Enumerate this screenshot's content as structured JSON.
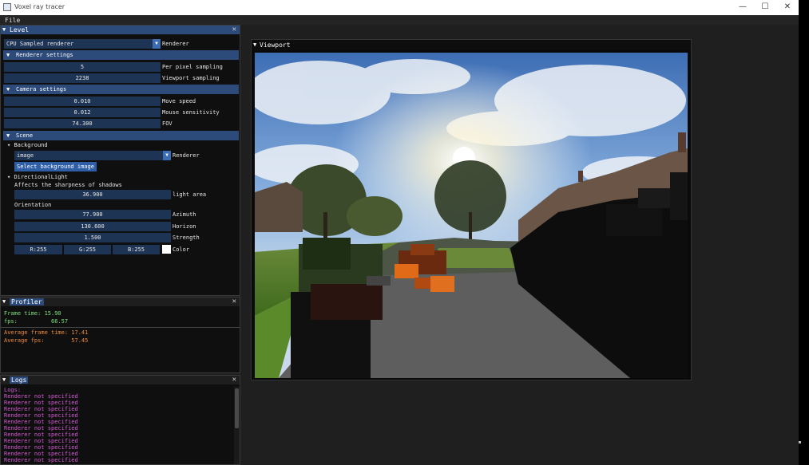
{
  "app": {
    "title": "Voxel ray tracer",
    "window_buttons": {
      "minimize": "—",
      "maximize": "☐",
      "close": "✕"
    }
  },
  "menu": {
    "file": "File"
  },
  "level_panel": {
    "title": "Level",
    "renderer_select": {
      "value": "CPU Sampled renderer",
      "label": "Renderer"
    },
    "renderer_settings": {
      "header": "Renderer settings",
      "per_pixel_sampling": {
        "value": "5",
        "label": "Per pixel sampling"
      },
      "viewport_sampling": {
        "value": "2238",
        "label": "Viewport sampling"
      }
    },
    "camera_settings": {
      "header": "Camera settings",
      "move_speed": {
        "value": "0.010",
        "label": "Move speed"
      },
      "mouse_sensitivity": {
        "value": "0.012",
        "label": "Mouse sensitivity"
      },
      "fov": {
        "value": "74.300",
        "label": "FOV"
      }
    },
    "scene": {
      "header": "Scene",
      "background": {
        "node": "Background",
        "renderer_select": {
          "value": "image",
          "label": "Renderer"
        },
        "select_button": "Select background image"
      },
      "directional_light": {
        "node": "DirectionalLight",
        "hint": "Affects the sharpness of shadows",
        "light_area": {
          "value": "36.900",
          "label": "light area"
        },
        "orientation_label": "Orientation",
        "azimuth": {
          "value": "77.900",
          "label": "Azimuth"
        },
        "horizon": {
          "value": "130.600",
          "label": "Horizon"
        },
        "strength": {
          "value": "1.500",
          "label": "Strength"
        },
        "color": {
          "r": "R:255",
          "g": "G:255",
          "b": "B:255",
          "label": "Color",
          "swatch": "#ffffff"
        }
      }
    }
  },
  "profiler": {
    "title": "Profiler",
    "frame_time": "Frame time: 15.90",
    "fps": "fps:          66.57",
    "avg_frame_time": "Average frame time: 17.41",
    "avg_fps": "Average fps:        57.45"
  },
  "logs": {
    "title": "Logs",
    "header": "Logs:",
    "lines": [
      "Renderer not specified",
      "Renderer not specified",
      "Renderer not specified",
      "Renderer not specified",
      "Renderer not specified",
      "Renderer not specified",
      "Renderer not specified",
      "Renderer not specified",
      "Renderer not specified",
      "Renderer not specified",
      "Renderer not specified"
    ]
  },
  "viewport": {
    "title": "Viewport"
  },
  "colors": {
    "accent": "#2c4a7a",
    "field": "#1d3455",
    "profiler_current": "#7ee07e",
    "profiler_average": "#f08b39",
    "log_text": "#d45ad4"
  }
}
